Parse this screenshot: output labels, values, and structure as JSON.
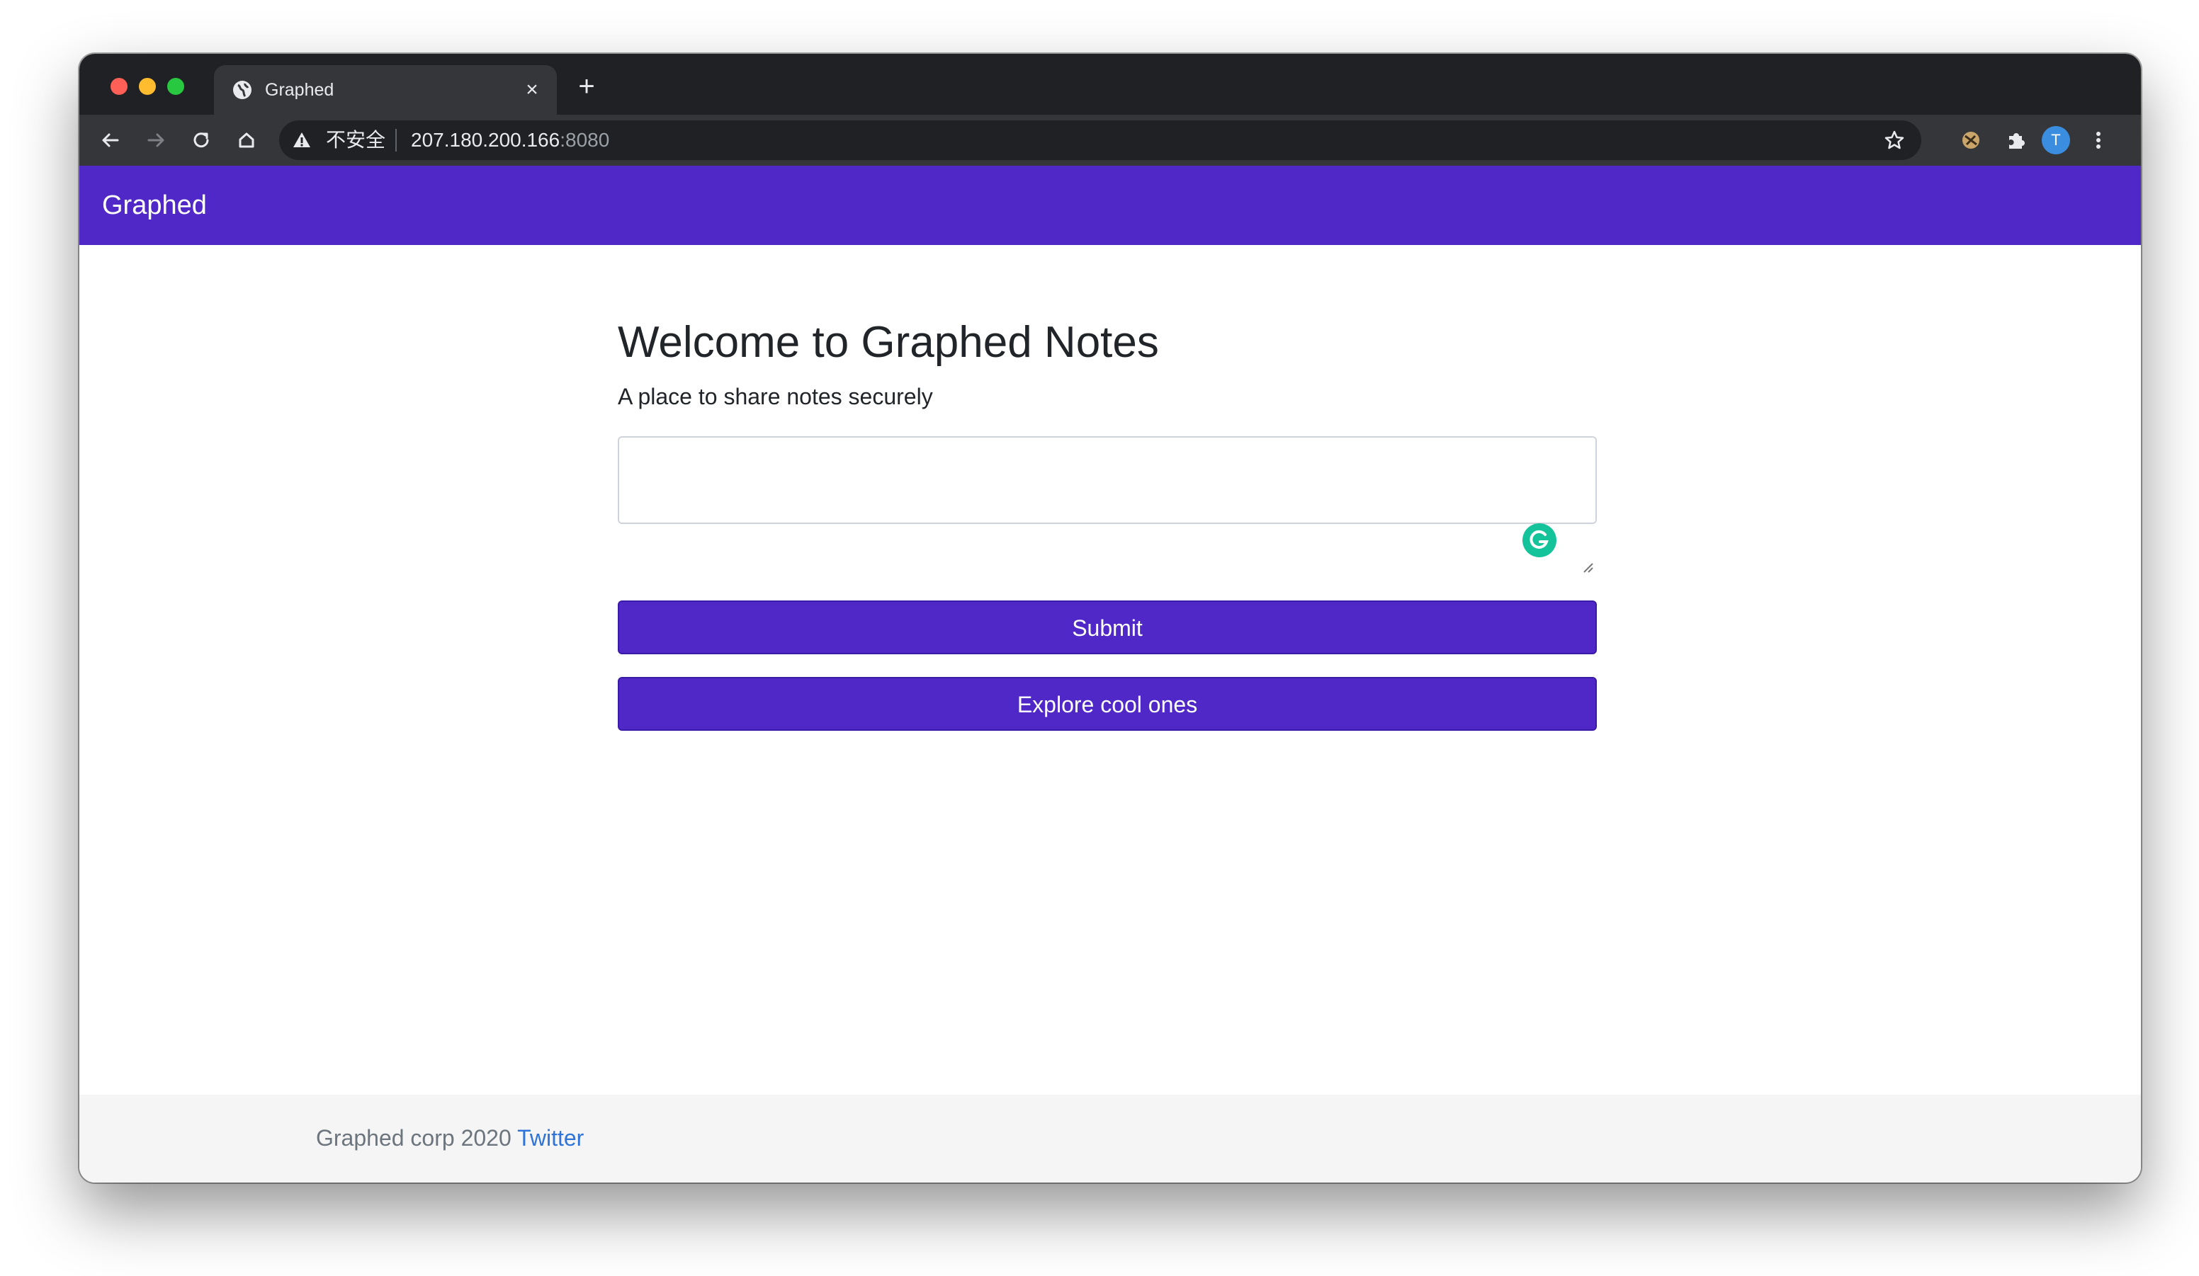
{
  "browser": {
    "tab_title": "Graphed",
    "new_tab_symbol": "+",
    "close_symbol": "×",
    "security_label": "不安全",
    "url_host": "207.180.200.166",
    "url_port": ":8080",
    "avatar_initial": "T",
    "icons": [
      "back-icon",
      "forward-icon",
      "reload-icon",
      "home-icon",
      "warning-icon",
      "star-icon",
      "extension-icon",
      "puzzle-icon",
      "menu-icon"
    ]
  },
  "navbar": {
    "brand": "Graphed",
    "color": "#5128c8"
  },
  "main": {
    "heading": "Welcome to Graphed Notes",
    "subtitle": "A place to share notes securely",
    "note_input_value": "",
    "submit_label": "Submit",
    "explore_label": "Explore cool ones"
  },
  "footer": {
    "text": "Graphed corp 2020",
    "link_label": "Twitter",
    "link_color": "#2f74d8"
  }
}
